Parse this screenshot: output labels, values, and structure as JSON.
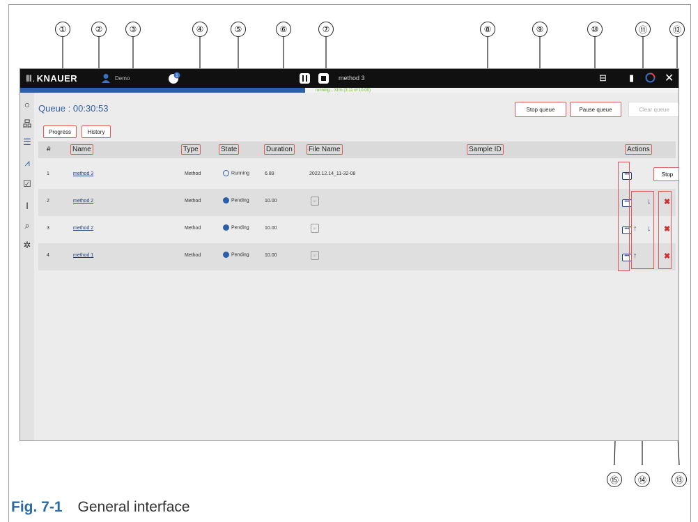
{
  "callouts": [
    "①",
    "②",
    "③",
    "④",
    "⑤",
    "⑥",
    "⑦",
    "⑧",
    "⑨",
    "⑩",
    "⑪",
    "⑫",
    "⑬",
    "⑭",
    "⑮"
  ],
  "app": {
    "brand": "KNAUER",
    "user": "Demo",
    "notification_count": "1",
    "method_name": "method 3",
    "run_status": "running... 31% (3.11 of 10.00)",
    "progress_fraction": 0.31,
    "accent_color": "#2b5fa8",
    "status_color": "#67b82a"
  },
  "queue": {
    "title": "Queue : 00:30:53",
    "tabs": {
      "progress": "Progress",
      "history": "History"
    },
    "buttons": {
      "stop": "Stop queue",
      "pause": "Pause queue",
      "clear": "Clear queue"
    }
  },
  "table": {
    "headers": {
      "index": "#",
      "name": "Name",
      "type": "Type",
      "state": "State",
      "duration": "Duration",
      "file_name": "File Name",
      "sample_id": "Sample ID",
      "actions": "Actions"
    },
    "rows": [
      {
        "index": "1",
        "name": "method 3",
        "type": "Method",
        "state": "Running",
        "duration": "6.89",
        "file_name": "2022.12.14_11-32-08"
      },
      {
        "index": "2",
        "name": "method 2",
        "type": "Method",
        "state": "Pending",
        "duration": "10.00",
        "file_name": ""
      },
      {
        "index": "3",
        "name": "method 2",
        "type": "Method",
        "state": "Pending",
        "duration": "10.00",
        "file_name": ""
      },
      {
        "index": "4",
        "name": "method 1",
        "type": "Method",
        "state": "Pending",
        "duration": "10.00",
        "file_name": ""
      }
    ],
    "stop_label": "Stop"
  },
  "caption": {
    "label": "Fig. 7-1",
    "text": "General interface"
  }
}
